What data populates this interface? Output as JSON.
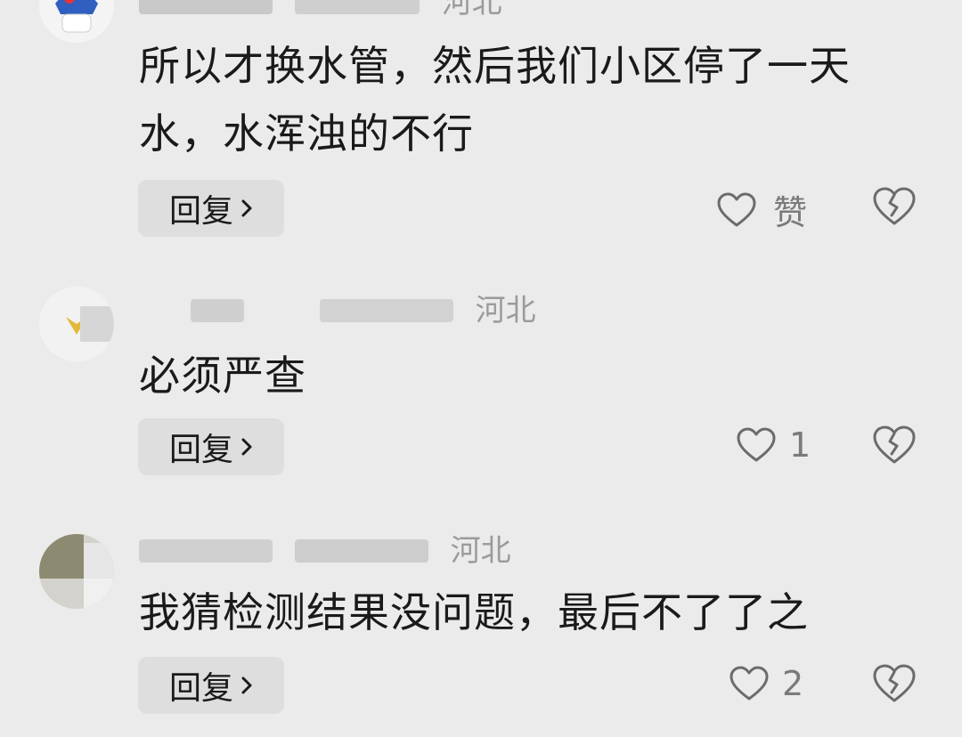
{
  "comments": [
    {
      "meta_location": "河北",
      "text": "所以才换水管，然后我们小区停了一天水，水浑浊的不行",
      "reply_label": "回复",
      "like_label": "赞",
      "like_count": ""
    },
    {
      "meta_location": "河北",
      "text": "必须严查",
      "reply_label": "回复",
      "like_label": "",
      "like_count": "1"
    },
    {
      "meta_location": "河北",
      "text": "我猜检测结果没问题，最后不了了之",
      "reply_label": "回复",
      "like_label": "",
      "like_count": "2"
    }
  ],
  "icons": {
    "like": "heart-outline-icon",
    "dislike": "broken-heart-icon",
    "reply_chevron": "chevron-right-icon"
  },
  "colors": {
    "background": "#ebebeb",
    "button_bg": "#dedede",
    "meta_text": "#9b9b9b",
    "icon_stroke": "#6b6b6b"
  }
}
